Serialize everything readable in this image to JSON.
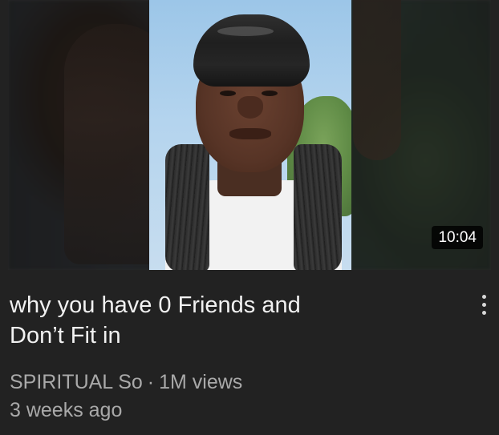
{
  "video": {
    "duration": "10:04",
    "title_line1": "why you have 0 Friends and",
    "title_line2": "Don’t Fit in",
    "channel": "SPIRITUAL So",
    "separator": "·",
    "views": "1M views",
    "age": "3 weeks ago",
    "more_icon": "more-vert-icon"
  },
  "colors": {
    "background": "#222222",
    "title_text": "#f1f1f1",
    "meta_text": "#a9a9a9",
    "duration_bg": "#000000"
  }
}
